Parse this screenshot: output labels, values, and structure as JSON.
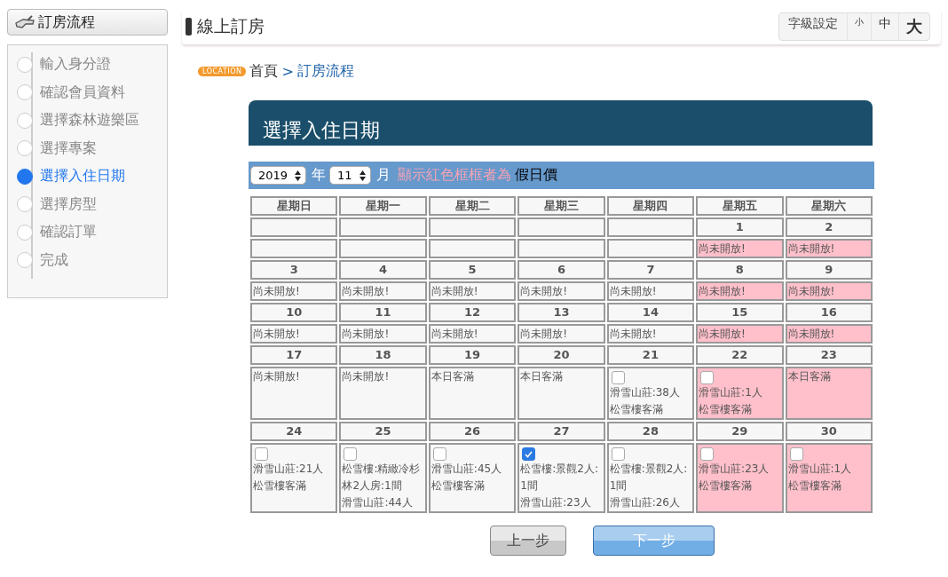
{
  "sidebar": {
    "title": "訂房流程",
    "steps": [
      {
        "label": "輸入身分證",
        "selected": false
      },
      {
        "label": "確認會員資料",
        "selected": false
      },
      {
        "label": "選擇森林遊樂區",
        "selected": false
      },
      {
        "label": "選擇專案",
        "selected": false
      },
      {
        "label": "選擇入住日期",
        "selected": true
      },
      {
        "label": "選擇房型",
        "selected": false
      },
      {
        "label": "確認訂單",
        "selected": false
      },
      {
        "label": "完成",
        "selected": false
      }
    ]
  },
  "header": {
    "title": "線上訂房",
    "font_setting": {
      "label": "字級設定",
      "sizes": [
        "小",
        "中",
        "大"
      ]
    }
  },
  "breadcrumb": {
    "badge": "LOCATION",
    "items": [
      "首頁",
      "訂房流程"
    ],
    "separator": ">"
  },
  "panel": {
    "title": "選擇入住日期",
    "toolbar": {
      "year": "2019",
      "year_unit": "年",
      "month": "11",
      "month_unit": "月",
      "note": "顯示紅色框框者為",
      "note_term": "假日價"
    },
    "weekdays": [
      "星期日",
      "星期一",
      "星期二",
      "星期三",
      "星期四",
      "星期五",
      "星期六"
    ],
    "weeks": [
      [
        {
          "holiday": false,
          "kind": "empty"
        },
        {
          "holiday": false,
          "kind": "empty"
        },
        {
          "holiday": false,
          "kind": "empty"
        },
        {
          "holiday": false,
          "kind": "empty"
        },
        {
          "holiday": false,
          "kind": "empty"
        },
        {
          "date": "1",
          "holiday": true,
          "kind": "text",
          "text": "尚未開放!"
        },
        {
          "date": "2",
          "holiday": true,
          "kind": "text",
          "text": "尚未開放!"
        }
      ],
      [
        {
          "date": "3",
          "holiday": false,
          "kind": "text",
          "text": "尚未開放!"
        },
        {
          "date": "4",
          "holiday": false,
          "kind": "text",
          "text": "尚未開放!"
        },
        {
          "date": "5",
          "holiday": false,
          "kind": "text",
          "text": "尚未開放!"
        },
        {
          "date": "6",
          "holiday": false,
          "kind": "text",
          "text": "尚未開放!"
        },
        {
          "date": "7",
          "holiday": false,
          "kind": "text",
          "text": "尚未開放!"
        },
        {
          "date": "8",
          "holiday": true,
          "kind": "text",
          "text": "尚未開放!"
        },
        {
          "date": "9",
          "holiday": true,
          "kind": "text",
          "text": "尚未開放!"
        }
      ],
      [
        {
          "date": "10",
          "holiday": false,
          "kind": "text",
          "text": "尚未開放!"
        },
        {
          "date": "11",
          "holiday": false,
          "kind": "text",
          "text": "尚未開放!"
        },
        {
          "date": "12",
          "holiday": false,
          "kind": "text",
          "text": "尚未開放!"
        },
        {
          "date": "13",
          "holiday": false,
          "kind": "text",
          "text": "尚未開放!"
        },
        {
          "date": "14",
          "holiday": false,
          "kind": "text",
          "text": "尚未開放!"
        },
        {
          "date": "15",
          "holiday": true,
          "kind": "text",
          "text": "尚未開放!"
        },
        {
          "date": "16",
          "holiday": true,
          "kind": "text",
          "text": "尚未開放!"
        }
      ],
      [
        {
          "date": "17",
          "holiday": false,
          "kind": "text",
          "text": "尚未開放!"
        },
        {
          "date": "18",
          "holiday": false,
          "kind": "text",
          "text": "尚未開放!"
        },
        {
          "date": "19",
          "holiday": false,
          "kind": "text",
          "text": "本日客滿"
        },
        {
          "date": "20",
          "holiday": false,
          "kind": "text",
          "text": "本日客滿"
        },
        {
          "date": "21",
          "holiday": false,
          "kind": "option",
          "checked": false,
          "lines": [
            "滑雪山莊:38人",
            "松雪樓客滿"
          ]
        },
        {
          "date": "22",
          "holiday": true,
          "kind": "option",
          "checked": false,
          "lines": [
            "滑雪山莊:1人",
            "松雪樓客滿"
          ]
        },
        {
          "date": "23",
          "holiday": true,
          "kind": "text",
          "text": "本日客滿"
        }
      ],
      [
        {
          "date": "24",
          "holiday": false,
          "kind": "option",
          "checked": false,
          "lines": [
            "滑雪山莊:21人",
            "松雪樓客滿"
          ]
        },
        {
          "date": "25",
          "holiday": false,
          "kind": "option",
          "checked": false,
          "lines": [
            "松雪樓:精緻冷杉林2人房:1間",
            "滑雪山莊:44人"
          ]
        },
        {
          "date": "26",
          "holiday": false,
          "kind": "option",
          "checked": false,
          "lines": [
            "滑雪山莊:45人",
            "松雪樓客滿"
          ]
        },
        {
          "date": "27",
          "holiday": false,
          "kind": "option",
          "checked": true,
          "lines": [
            "松雪樓:景觀2人:1間",
            "滑雪山莊:23人"
          ]
        },
        {
          "date": "28",
          "holiday": false,
          "kind": "option",
          "checked": false,
          "lines": [
            "松雪樓:景觀2人:1間",
            "滑雪山莊:26人"
          ]
        },
        {
          "date": "29",
          "holiday": true,
          "kind": "option",
          "checked": false,
          "lines": [
            "滑雪山莊:23人",
            "松雪樓客滿"
          ]
        },
        {
          "date": "30",
          "holiday": true,
          "kind": "option",
          "checked": false,
          "lines": [
            "滑雪山莊:1人",
            "松雪樓客滿"
          ]
        }
      ]
    ]
  },
  "buttons": [
    {
      "label": "上一步",
      "kind": "back"
    },
    {
      "label": "下一步",
      "kind": "next"
    }
  ]
}
